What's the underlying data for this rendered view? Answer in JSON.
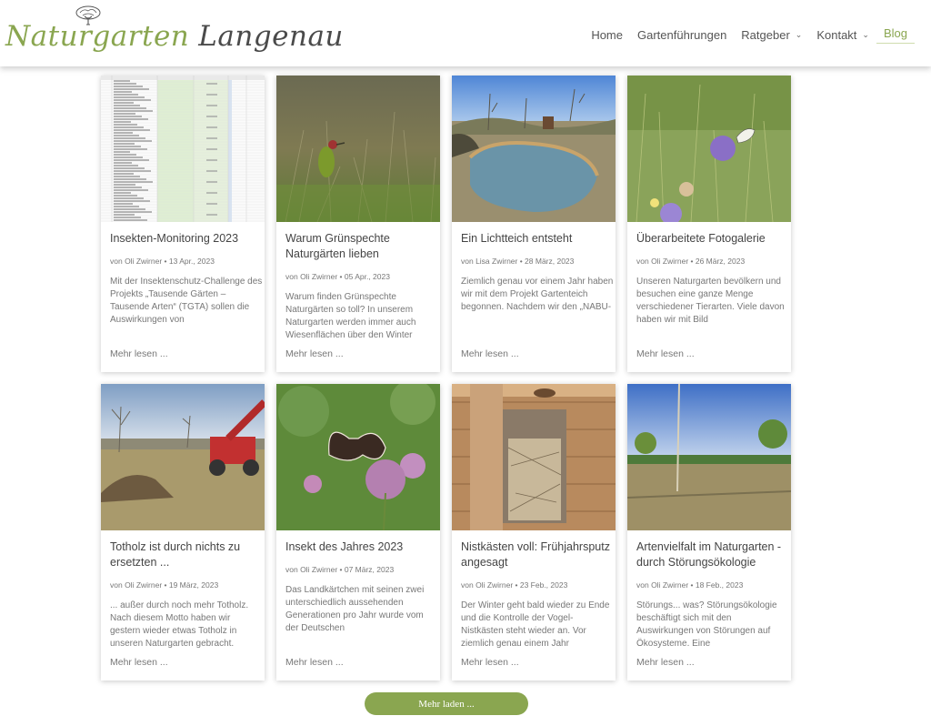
{
  "site": {
    "logo_word1": "Naturgarten",
    "logo_word2": "Langenau"
  },
  "nav": [
    {
      "label": "Home",
      "dropdown": false,
      "active": false
    },
    {
      "label": "Gartenführungen",
      "dropdown": false,
      "active": false
    },
    {
      "label": "Ratgeber",
      "dropdown": true,
      "active": false
    },
    {
      "label": "Kontakt",
      "dropdown": true,
      "active": false
    },
    {
      "label": "Blog",
      "dropdown": false,
      "active": true
    }
  ],
  "colors": {
    "accent": "#8aa650",
    "text": "#555555"
  },
  "posts": [
    {
      "title": "Insekten-Monitoring 2023",
      "meta": "von Oli Zwirner • 13 Apr., 2023",
      "excerpt": "Mit der Insektenschutz-Challenge des Projekts „Tausende Gärten – Tausende Arten“ (TGTA) sollen die Auswirkungen von",
      "more": "Mehr lesen ...",
      "image": "spreadsheet"
    },
    {
      "title": "Warum Grünspechte Naturgärten lieben",
      "meta": "von Oli Zwirner • 05 Apr., 2023",
      "excerpt": "Warum finden Grünspechte Naturgärten so toll? In unserem Naturgarten werden immer auch Wiesenflächen über den Winter",
      "more": "Mehr lesen ...",
      "image": "woodpecker"
    },
    {
      "title": "Ein Lichtteich entsteht",
      "meta": "von Lisa Zwirner • 28 März, 2023",
      "excerpt": "Ziemlich genau vor einem Jahr haben wir mit dem Projekt Gartenteich begonnen. Nachdem wir den „NABU-",
      "more": "Mehr lesen ...",
      "image": "pond"
    },
    {
      "title": "Überarbeitete Fotogalerie",
      "meta": "von Oli Zwirner • 26 März, 2023",
      "excerpt": "Unseren Naturgarten bevölkern und besuchen eine ganze Menge verschiedener Tierarten. Viele davon haben wir mit Bild",
      "more": "Mehr lesen ...",
      "image": "butterfly-meadow"
    },
    {
      "title": "Totholz ist durch nichts zu ersetzten ...",
      "meta": "von Oli Zwirner • 19 März, 2023",
      "excerpt": "... außer durch noch mehr Totholz. Nach diesem Motto haben wir gestern wieder etwas Totholz in unseren Naturgarten gebracht.",
      "more": "Mehr lesen ...",
      "image": "deadwood"
    },
    {
      "title": "Insekt des Jahres 2023",
      "meta": "von Oli Zwirner • 07 März, 2023",
      "excerpt": "Das Landkärtchen mit seinen zwei unterschiedlich aussehenden Generationen pro Jahr wurde vom der Deutschen",
      "more": "Mehr lesen ...",
      "image": "map-butterfly"
    },
    {
      "title": "Nistkästen voll: Frühjahrsputz angesagt",
      "meta": "von Oli Zwirner • 23 Feb., 2023",
      "excerpt": "Der Winter geht bald wieder zu Ende und die Kontrolle der Vogel-Nistkästen steht wieder an. Vor ziemlich genau einem Jahr",
      "more": "Mehr lesen ...",
      "image": "nestbox"
    },
    {
      "title": "Artenvielfalt im Naturgarten - durch Störungsökologie",
      "meta": "von Oli Zwirner • 18 Feb., 2023",
      "excerpt": "Störungs... was? Störungsökologie beschäftigt sich mit den Auswirkungen von Störungen auf Ökosysteme. Eine",
      "more": "Mehr lesen ...",
      "image": "field-trees"
    }
  ],
  "load_more": "Mehr laden ..."
}
